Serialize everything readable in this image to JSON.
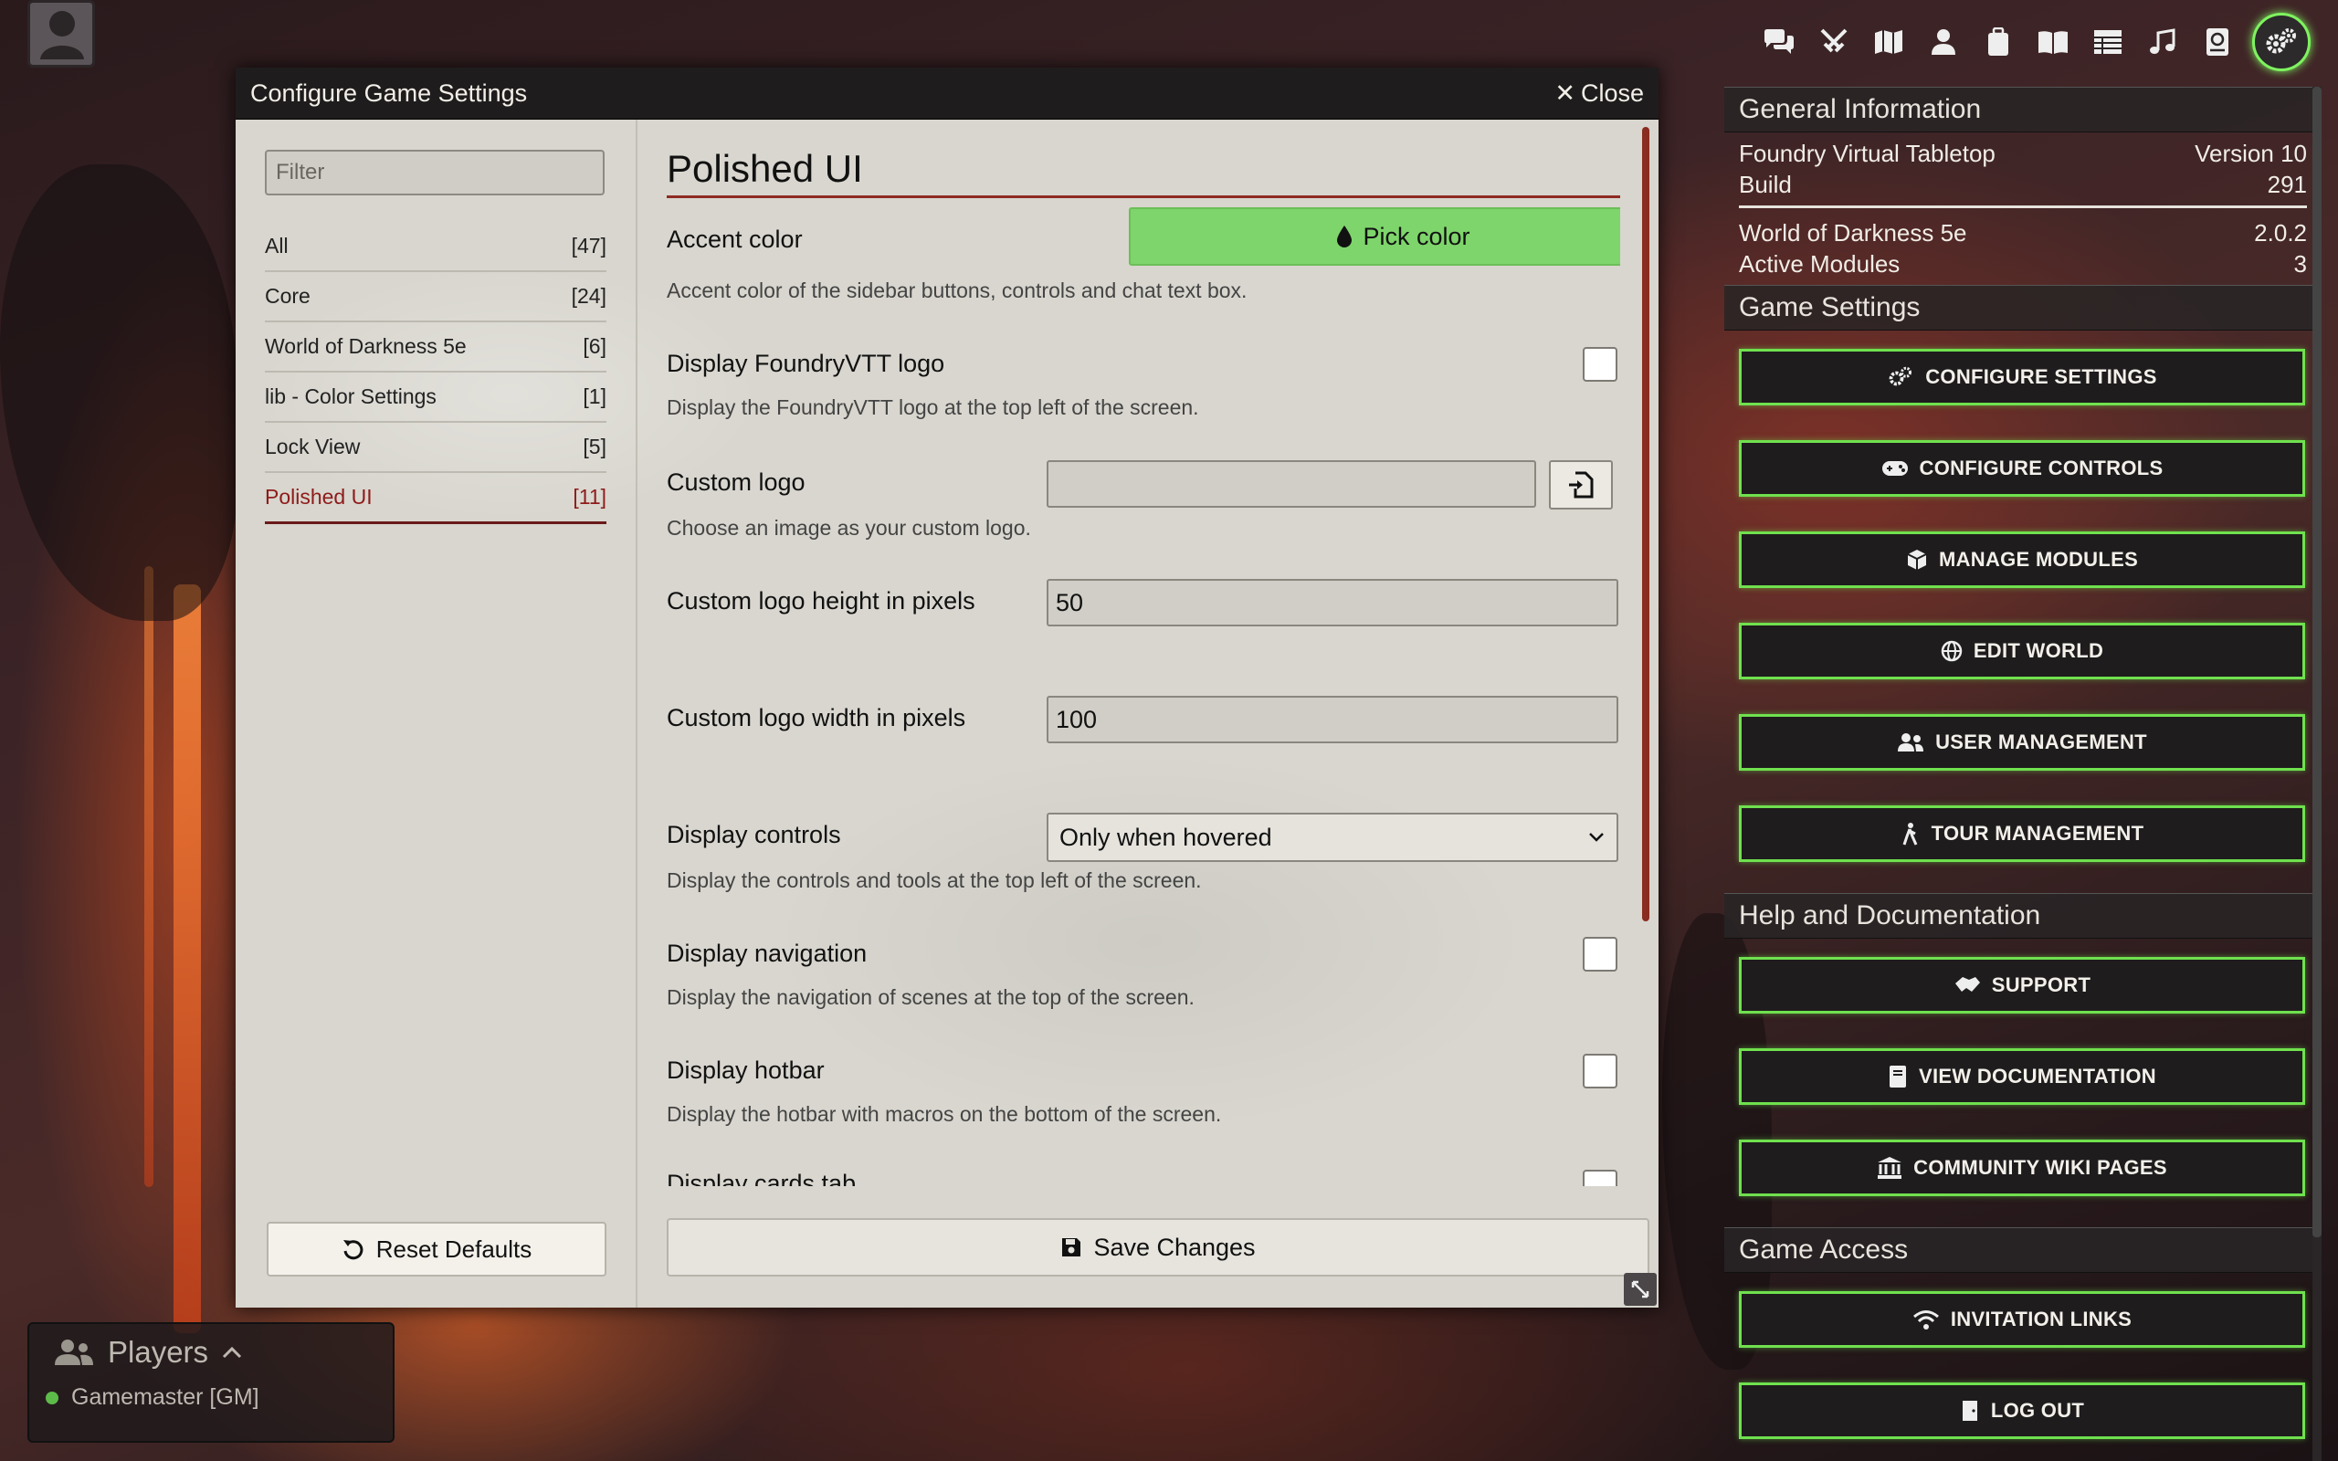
{
  "dialog": {
    "title": "Configure Game Settings",
    "close_label": "Close",
    "filter_placeholder": "Filter",
    "categories": [
      {
        "label": "All",
        "count": "[47]"
      },
      {
        "label": "Core",
        "count": "[24]"
      },
      {
        "label": "World of Darkness 5e",
        "count": "[6]"
      },
      {
        "label": "lib - Color Settings",
        "count": "[1]"
      },
      {
        "label": "Lock View",
        "count": "[5]"
      },
      {
        "label": "Polished UI",
        "count": "[11]"
      }
    ],
    "active_category": "Polished UI",
    "reset_label": "Reset Defaults",
    "save_label": "Save Changes",
    "module_title": "Polished UI",
    "settings": {
      "accent": {
        "label": "Accent color",
        "button": "Pick color",
        "hint": "Accent color of the sidebar buttons, controls and chat text box."
      },
      "logo": {
        "label": "Display FoundryVTT logo",
        "hint": "Display the FoundryVTT logo at the top left of the screen.",
        "checked": false
      },
      "custom_logo": {
        "label": "Custom logo",
        "hint": "Choose an image as your custom logo.",
        "value": ""
      },
      "logo_height": {
        "label": "Custom logo height in pixels",
        "value": "50"
      },
      "logo_width": {
        "label": "Custom logo width in pixels",
        "value": "100"
      },
      "controls": {
        "label": "Display controls",
        "value": "Only when hovered",
        "hint": "Display the controls and tools at the top left of the screen."
      },
      "navigation": {
        "label": "Display navigation",
        "hint": "Display the navigation of scenes at the top of the screen.",
        "checked": false
      },
      "hotbar": {
        "label": "Display hotbar",
        "hint": "Display the hotbar with macros on the bottom of the screen.",
        "checked": false
      },
      "cards": {
        "label": "Display cards tab"
      }
    }
  },
  "sidebar": {
    "tabs": [
      "chat-icon",
      "combat-icon",
      "scenes-icon",
      "actors-icon",
      "items-icon",
      "journal-icon",
      "tables-icon",
      "playlists-icon",
      "compendium-icon",
      "settings-icon"
    ],
    "general_info": {
      "heading": "General Information",
      "rows": [
        {
          "label": "Foundry Virtual Tabletop",
          "value": "Version 10"
        },
        {
          "label": "Build",
          "value": "291"
        }
      ],
      "system_rows": [
        {
          "label": "World of Darkness 5e",
          "value": "2.0.2"
        },
        {
          "label": "Active Modules",
          "value": "3"
        }
      ]
    },
    "game_settings": {
      "heading": "Game Settings",
      "buttons": [
        "CONFIGURE SETTINGS",
        "CONFIGURE CONTROLS",
        "MANAGE MODULES",
        "EDIT WORLD",
        "USER MANAGEMENT",
        "TOUR MANAGEMENT"
      ]
    },
    "help": {
      "heading": "Help and Documentation",
      "buttons": [
        "SUPPORT",
        "VIEW DOCUMENTATION",
        "COMMUNITY WIKI PAGES"
      ]
    },
    "access": {
      "heading": "Game Access",
      "buttons": [
        "INVITATION LINKS",
        "LOG OUT"
      ]
    },
    "accent_color": "#6fe14e"
  },
  "players": {
    "heading": "Players",
    "list": [
      {
        "name": "Gamemaster [GM]"
      }
    ]
  }
}
